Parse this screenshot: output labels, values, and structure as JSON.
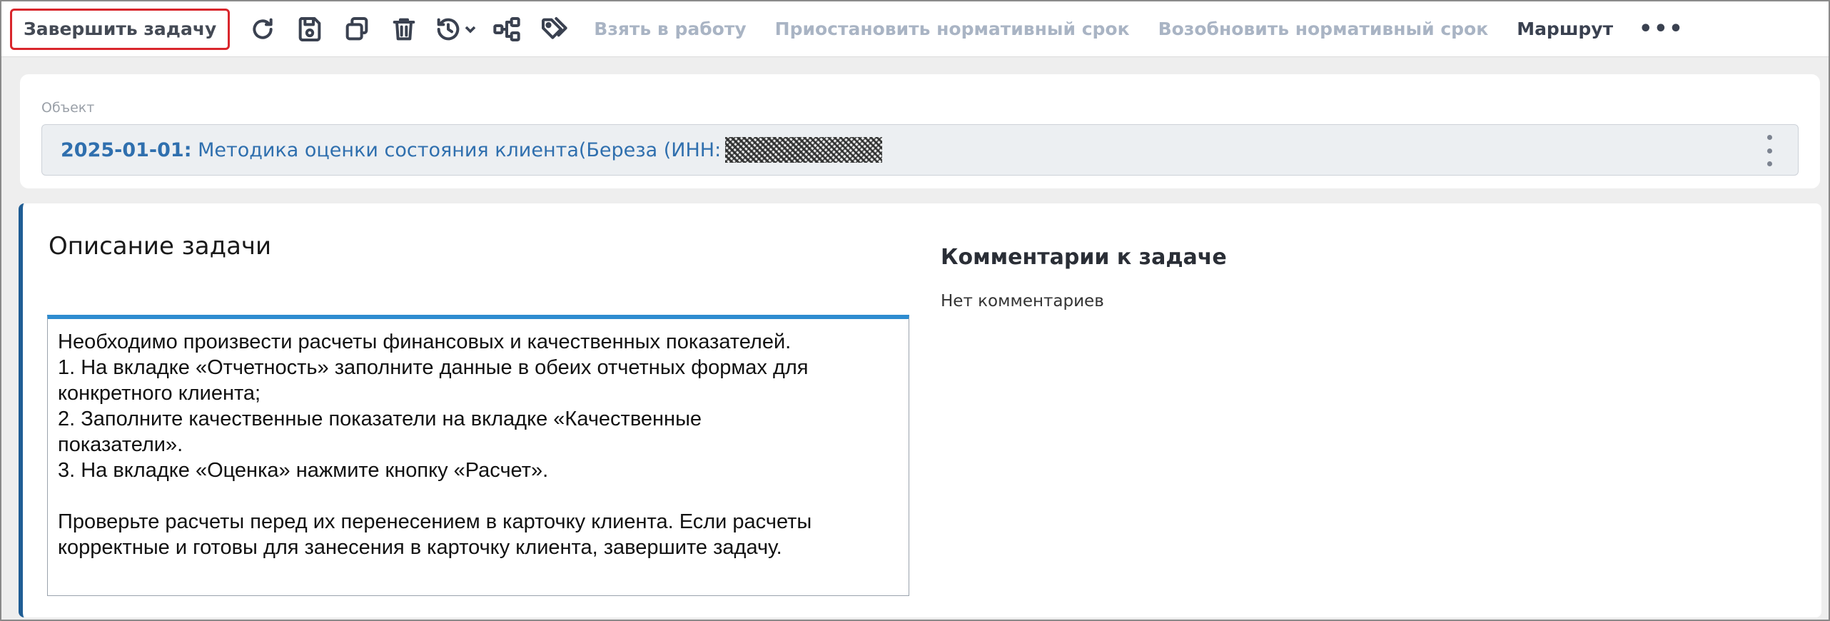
{
  "toolbar": {
    "complete_label": "Завершить задачу",
    "icons": [
      "refresh-icon",
      "save-icon",
      "copy-icon",
      "delete-icon",
      "history-icon",
      "route-graph-icon",
      "tags-icon"
    ],
    "take_label": "Взять в работу",
    "suspend_label": "Приостановить нормативный срок",
    "resume_label": "Возобновить нормативный срок",
    "route_label": "Маршрут",
    "more_label": "•••"
  },
  "object": {
    "label": "Объект",
    "code": "2025-01-01:",
    "text": " Методика оценки состояния клиента(Береза (ИНН:"
  },
  "description": {
    "title": "Описание задачи",
    "lines": [
      "Необходимо произвести расчеты финансовых и качественных показателей.",
      "1. На вкладке «Отчетность» заполните данные в обеих отчетных формах для",
      "конкретного клиента;",
      "2. Заполните качественные показатели на вкладке «Качественные",
      "показатели».",
      "3. На вкладке «Оценка» нажмите кнопку «Расчет».",
      "Проверьте расчеты перед их перенесением в карточку клиента. Если расчеты",
      "корректные и готовы для занесения в карточку клиента, завершите задачу."
    ]
  },
  "comments": {
    "title": "Комментарии к задаче",
    "empty_text": "Нет комментариев"
  },
  "colors": {
    "accent_border": "#d9262c",
    "link_blue": "#2f6fae",
    "panel_stripe": "#1f5d94",
    "editor_top": "#2e8cd0",
    "disabled_text": "#a9b4c4"
  }
}
